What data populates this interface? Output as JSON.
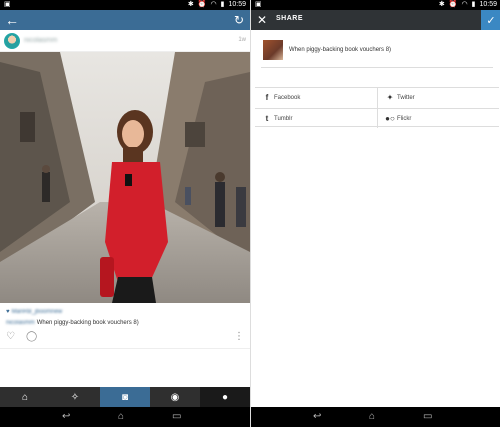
{
  "status_bar": {
    "time": "10:59"
  },
  "feed": {
    "username": "nicolasmm",
    "timestamp": "1w",
    "likes_text": "ManRB_jboomnew",
    "caption_user": "nicolasmm",
    "caption_text": "When piggy-backing book vouchers 8)"
  },
  "share": {
    "title": "SHARE",
    "caption": "When piggy-backing book vouchers 8)",
    "services": [
      {
        "label": "Facebook",
        "icon": "facebook-icon"
      },
      {
        "label": "Twitter",
        "icon": "twitter-icon"
      },
      {
        "label": "Tumblr",
        "icon": "tumblr-icon"
      },
      {
        "label": "Flickr",
        "icon": "flickr-icon"
      }
    ]
  },
  "colors": {
    "instagram_blue": "#3b6c95",
    "share_header": "#2f3336",
    "confirm": "#3b88c3"
  }
}
